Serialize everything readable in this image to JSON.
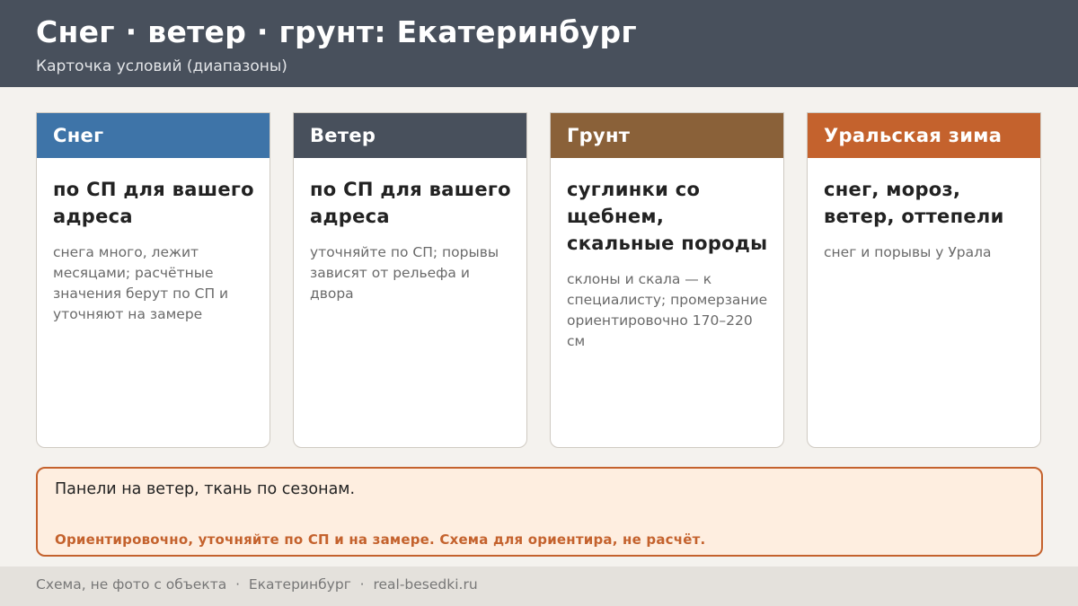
{
  "header": {
    "title": "Снег · ветер · грунт: Екатеринбург",
    "subtitle": "Карточка условий (диапазоны)"
  },
  "cards": [
    {
      "title": "Снег",
      "color": "#3e74a8",
      "main": "по СП для вашего адреса",
      "note": "снега много, лежит месяцами; расчётные значения берут по СП и уточняют на замере"
    },
    {
      "title": "Ветер",
      "color": "#48505c",
      "main": "по СП для вашего адреса",
      "note": "уточняйте по СП; порывы зависят от рельефа и двора"
    },
    {
      "title": "Грунт",
      "color": "#8a6139",
      "main": "суглинки со щебнем, скальные породы",
      "note": "склоны и скала — к специалисту; промерзание ориентировочно 170–220 см"
    },
    {
      "title": "Уральская зима",
      "color": "#c4622d",
      "main": "снег, мороз, ветер, оттепели",
      "note": "снег и порывы у Урала"
    }
  ],
  "note_box": {
    "text": "Панели на ветер, ткань по сезонам.",
    "disclaimer": "Ориентировочно, уточняйте по СП и на замере. Схема для ориентира, не расчёт."
  },
  "footer": {
    "text": "Схема, не фото с объекта  ·  Екатеринбург  ·  real-besedki.ru"
  }
}
